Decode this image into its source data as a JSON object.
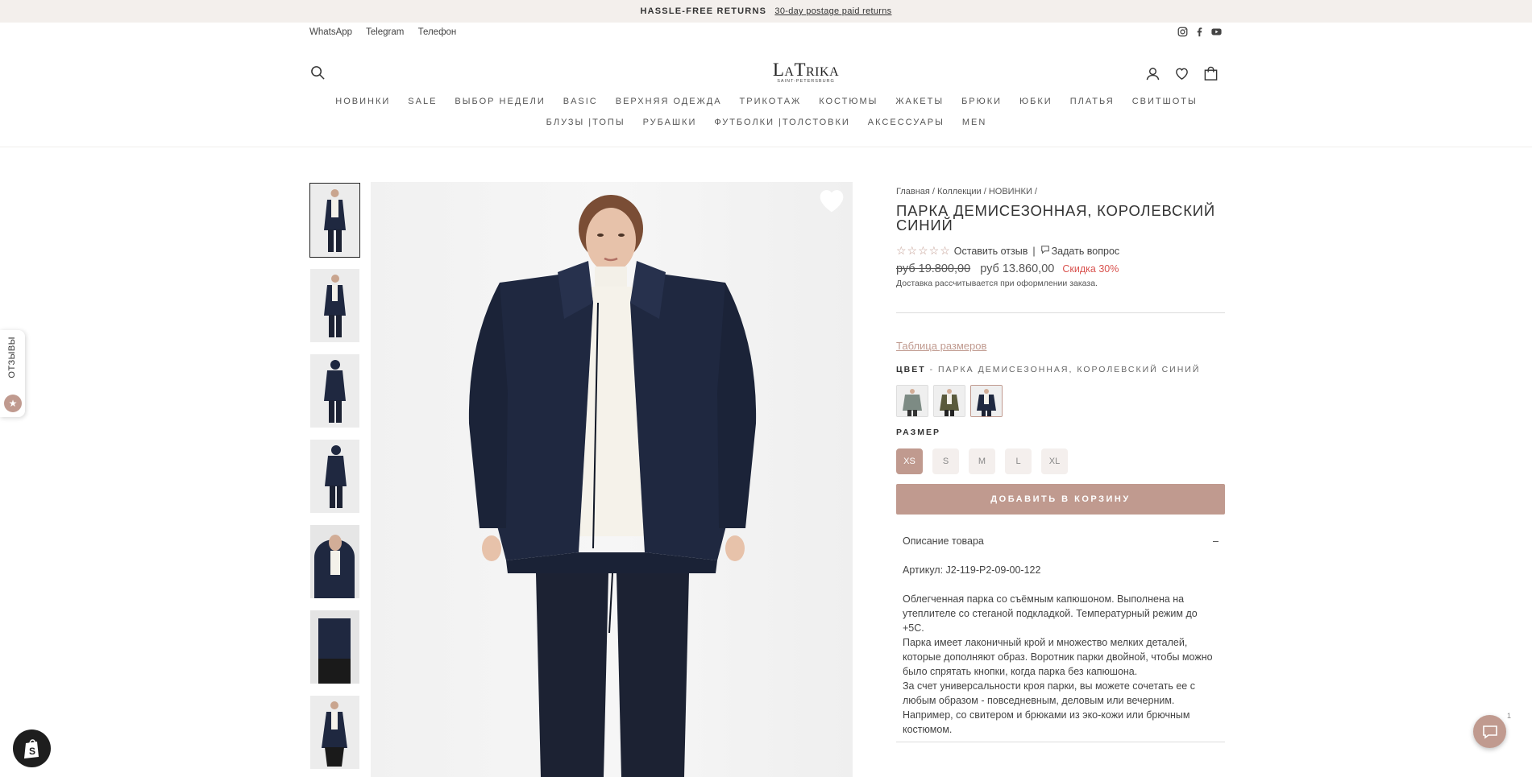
{
  "announcement": {
    "bold": "HASSLE-FREE RETURNS",
    "link": "30-day postage paid returns"
  },
  "top_links": [
    "WhatsApp",
    "Telegram",
    "Телефон"
  ],
  "logo": {
    "main": "LaTrika",
    "sub": "SAINT-PETERSBURG"
  },
  "nav_row1": [
    "НОВИНКИ",
    "SALE",
    "ВЫБОР НЕДЕЛИ",
    "BASIC",
    "ВЕРХНЯЯ ОДЕЖДА",
    "ТРИКОТАЖ",
    "КОСТЮМЫ",
    "ЖАКЕТЫ",
    "БРЮКИ",
    "ЮБКИ",
    "ПЛАТЬЯ",
    "СВИТШОТЫ"
  ],
  "nav_row2": [
    "БЛУЗЫ |ТОПЫ",
    "РУБАШКИ",
    "ФУТБОЛКИ |ТОЛСТОВКИ",
    "АКСЕССУАРЫ",
    "MEN"
  ],
  "reviews_tab": "ОТЗЫВЫ",
  "product": {
    "breadcrumbs": "Главная / Коллекции / НОВИНКИ /",
    "title": "ПАРКА ДЕМИСЕЗОННАЯ, КОРОЛЕВСКИЙ СИНИЙ",
    "stars": "☆☆☆☆☆",
    "leave_review": "Оставить отзыв",
    "separator": "|",
    "ask_question": "Задать вопрос",
    "old_price": "руб 19.800,00",
    "price": "руб 13.860,00",
    "discount": "Скидка 30%",
    "shipping": "Доставка рассчитывается при оформлении заказа.",
    "size_chart": "Таблица размеров",
    "color_label": "ЦВЕТ",
    "color_value": "- ПАРКА ДЕМИСЕЗОННАЯ, КОРОЛЕВСКИЙ СИНИЙ",
    "swatch_colors": [
      "#7d8b84",
      "#5a5a3c",
      "#1f2840"
    ],
    "size_label": "РАЗМЕР",
    "sizes": [
      "XS",
      "S",
      "M",
      "L",
      "XL"
    ],
    "selected_size": "XS",
    "add_to_cart": "ДОБАВИТЬ В КОРЗИНУ",
    "description_title": "Описание товара",
    "description_toggle": "–",
    "article": "Артикул: J2-119-P2-09-00-122",
    "desc_p1": "Облегченная парка со съёмным капюшоном. Выполнена на утеплителе со стеганой подкладкой. Температурный режим до +5С.",
    "desc_p2": "Парка имеет лаконичный крой и множество мелких деталей, которые дополняют образ. Воротник парки двойной, чтобы можно было спрятать кнопки, когда парка без капюшона.",
    "desc_p3": "За счет универсальности кроя парки, вы можете сочетать ее с любым образом - повседневным, деловым или вечерним. Например, со свитером и брюками из эко-кожи или брючным костюмом."
  },
  "chat_badge_count": "1",
  "colors": {
    "accent": "#c09a8f",
    "navy": "#1f2840",
    "sale": "#d9534f"
  }
}
